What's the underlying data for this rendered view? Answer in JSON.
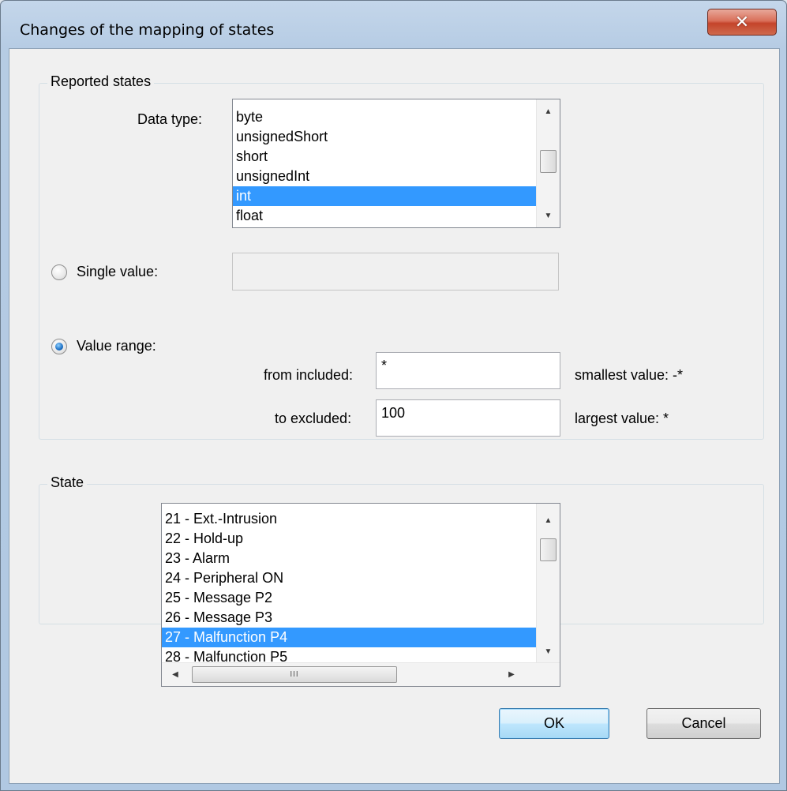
{
  "window": {
    "title": "Changes of the mapping of states",
    "close_icon": "close-icon"
  },
  "reported_states": {
    "group_label": "Reported states",
    "data_type_label": "Data type:",
    "data_types": [
      "byte",
      "unsignedShort",
      "short",
      "unsignedInt",
      "int",
      "float"
    ],
    "selected_data_type": "int",
    "single_value": {
      "label": "Single value:",
      "checked": false,
      "value": ""
    },
    "value_range": {
      "label": "Value range:",
      "checked": true,
      "from_label": "from included:",
      "from_value": "*",
      "to_label": "to excluded:",
      "to_value": "100",
      "smallest_label": "smallest value: -*",
      "largest_label": "largest value: *"
    }
  },
  "state": {
    "group_label": "State",
    "items": [
      "21 - Ext.-Intrusion",
      "22 - Hold-up",
      "23 - Alarm",
      "24 - Peripheral ON",
      "25 - Message P2",
      "26 - Message P3",
      "27 - Malfunction P4",
      "28 - Malfunction P5"
    ],
    "selected": "27 - Malfunction P4",
    "hscroll_grip": "III"
  },
  "buttons": {
    "ok": "OK",
    "cancel": "Cancel"
  },
  "colors": {
    "selection": "#3399ff",
    "close_button": "#c4442a",
    "dialog_bg": "#f0f0f0"
  }
}
